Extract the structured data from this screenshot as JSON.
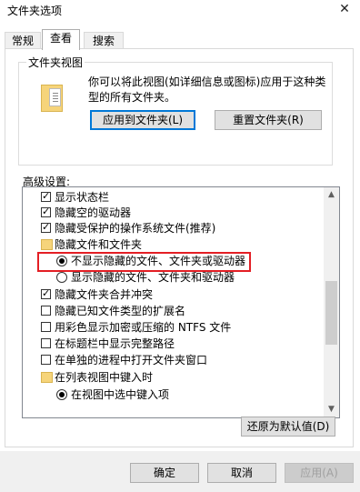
{
  "window": {
    "title": "文件夹选项",
    "close_symbol": "✕"
  },
  "tabs": [
    {
      "label": "常规"
    },
    {
      "label": "查看"
    },
    {
      "label": "搜索"
    }
  ],
  "folder_views": {
    "legend": "文件夹视图",
    "description": "你可以将此视图(如详细信息或图标)应用于这种类型的所有文件夹。",
    "apply_button": "应用到文件夹(L)",
    "reset_button": "重置文件夹(R)"
  },
  "advanced": {
    "label": "高级设置:",
    "items": [
      {
        "type": "checkbox",
        "checked": true,
        "label": "显示状态栏"
      },
      {
        "type": "checkbox",
        "checked": true,
        "label": "隐藏空的驱动器"
      },
      {
        "type": "checkbox",
        "checked": true,
        "label": "隐藏受保护的操作系统文件(推荐)"
      },
      {
        "type": "folder",
        "label": "隐藏文件和文件夹"
      },
      {
        "type": "radio",
        "checked": true,
        "label": "不显示隐藏的文件、文件夹或驱动器"
      },
      {
        "type": "radio",
        "checked": false,
        "label": "显示隐藏的文件、文件夹和驱动器"
      },
      {
        "type": "checkbox",
        "checked": true,
        "label": "隐藏文件夹合并冲突"
      },
      {
        "type": "checkbox",
        "checked": false,
        "label": "隐藏已知文件类型的扩展名"
      },
      {
        "type": "checkbox",
        "checked": false,
        "label": "用彩色显示加密或压缩的 NTFS 文件"
      },
      {
        "type": "checkbox",
        "checked": false,
        "label": "在标题栏中显示完整路径"
      },
      {
        "type": "checkbox",
        "checked": false,
        "label": "在单独的进程中打开文件夹窗口"
      },
      {
        "type": "folder",
        "label": "在列表视图中键入时"
      },
      {
        "type": "radio",
        "checked": true,
        "label": "在视图中选中键入项"
      }
    ],
    "restore_button": "还原为默认值(D)"
  },
  "footer": {
    "ok": "确定",
    "cancel": "取消",
    "apply": "应用(A)"
  },
  "colors": {
    "highlight_border": "#e31e24",
    "primary_button_border": "#0078d7",
    "folder": "#f6d47a"
  }
}
